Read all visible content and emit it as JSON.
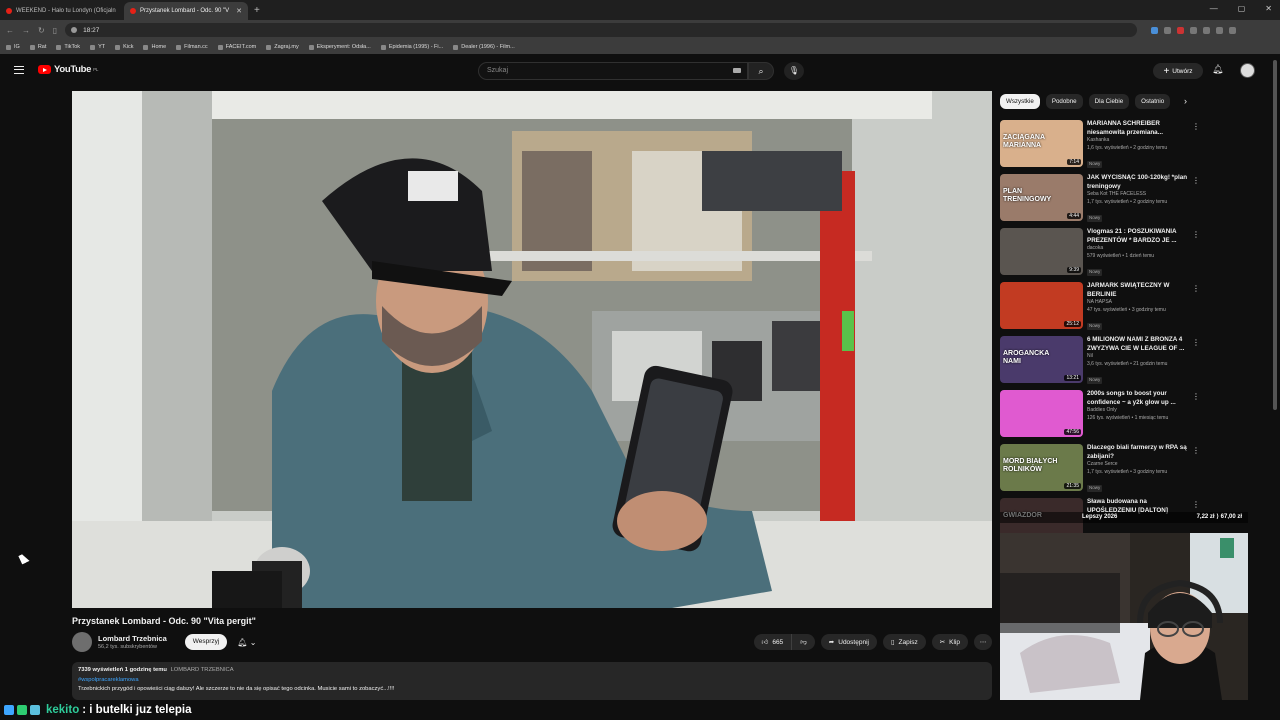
{
  "browser": {
    "tabs": [
      {
        "title": "WEEKEND - Hało tu Londyn (Oficjaln",
        "active": false
      },
      {
        "title": "Przystanek Lombard - Odc. 90 \"V",
        "active": true
      }
    ],
    "new_tab": "+",
    "address": "18:27",
    "bookmarks": [
      "IG",
      "Rat",
      "TikTok",
      "YT",
      "Kick",
      "Home",
      "Filman.cc",
      "FACEIT.com",
      "Zagraj.my",
      "Eksperyment: Odsła...",
      "Epidemia (1995) - Fi...",
      "Dealer (1996) - Film..."
    ]
  },
  "youtube": {
    "logo_text": "YouTube",
    "region": "PL",
    "search_placeholder": "Szukaj",
    "create_label": "Utwórz"
  },
  "video": {
    "title": "Przystanek Lombard - Odc. 90 \"Vita pergit\"",
    "channel": "Lombard Trzebnica",
    "subscribers": "56,2 tys. subskrybentów",
    "support_label": "Wesprzyj",
    "likes": "665",
    "share_label": "Udostępnij",
    "save_label": "Zapisz",
    "clip_label": "Klip",
    "views": "7339 wyświetleń",
    "posted": "1 godzinę temu",
    "channel_caps": "LOMBARD TRZEBNICA",
    "hashtag": "#wspolpracareklamowa",
    "description": "Trzebnickich przygód i opowieści ciąg dalszy! Ale szczerze to nie da się opisać tego odcinka. Musicie sami to zobaczyć...!!!!"
  },
  "chips": [
    "Wszystkie",
    "Podobne",
    "Dla Ciebie",
    "Ostatnio"
  ],
  "recommendations": [
    {
      "title": "MARIANNA SCHREIBER niesamowita przemiana...",
      "channel": "Kashanka",
      "stats": "1,6 tys. wyświetleń • 2 godziny temu",
      "badge": "Nowy",
      "duration": "7:14",
      "thumb_color": "#d9b08c",
      "thumb_text": "ZACIĄGANA MARIANNA"
    },
    {
      "title": "JAK WYCISNĄĆ 100-120kg! *plan treningowy",
      "channel": "Seba Kot THE FACELESS",
      "stats": "1,7 tys. wyświetleń • 2 godziny temu",
      "badge": "Nowy",
      "duration": "4:44",
      "thumb_color": "#9a7b6a",
      "thumb_text": "PLAN TRENINGOWY"
    },
    {
      "title": "Vlogmas 21 : POSZUKIWANIA PREZENTÓW * BARDZO JE ...",
      "channel": "dacoka",
      "stats": "579 wyświetleń • 1 dzień temu",
      "badge": "Nowy",
      "duration": "9:39",
      "thumb_color": "#5a5550",
      "thumb_text": ""
    },
    {
      "title": "JARMARK ŚWIĄTECZNY W BERLINIE",
      "channel": "NA HAPSA",
      "stats": "47 tys. wyświetleń • 3 godziny temu",
      "badge": "Nowy",
      "duration": "25:12",
      "thumb_color": "#c23b22",
      "thumb_text": ""
    },
    {
      "title": "6 MILIONOW NAMI Z BRONZA 4 ZWYZYWA CIE W LEAGUE OF ...",
      "channel": "Nil",
      "stats": "3,6 tys. wyświetleń • 21 godzin temu",
      "badge": "Nowy",
      "duration": "13:21",
      "thumb_color": "#4a3a6b",
      "thumb_text": "AROGANCKA NAMI"
    },
    {
      "title": "2000s songs to boost your confidence ~ a y2k glow up ...",
      "channel": "Baddies Only",
      "stats": "126 tys. wyświetleń • 1 miesiąc temu",
      "badge": "",
      "duration": "47:56",
      "thumb_color": "#e05ad0",
      "thumb_text": ""
    },
    {
      "title": "Dlaczego biali farmerzy w RPA są zabijani?",
      "channel": "Czarne Serce",
      "stats": "1,7 tys. wyświetleń • 3 godziny temu",
      "badge": "Nowy",
      "duration": "21:35",
      "thumb_color": "#6b7a4a",
      "thumb_text": "MORD BIAŁYCH ROLNIKÓW"
    },
    {
      "title": "Sława budowana na UPOŚLEDZENIU [DALTON]",
      "channel": "",
      "stats": "",
      "badge": "",
      "duration": "",
      "thumb_color": "#3a2a2a",
      "thumb_text": "GWIAZDOR"
    }
  ],
  "overlay": {
    "left": "Lepszy 2026",
    "right": "7,22 zł ⟩ 67,00 zł"
  },
  "chat": {
    "user": "kekito",
    "message": ": i butelki juz telepia"
  }
}
